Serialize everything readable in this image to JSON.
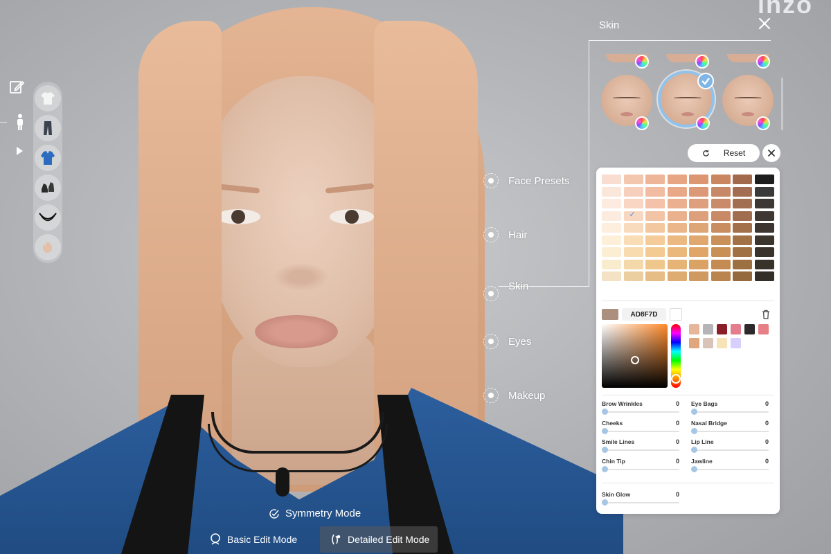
{
  "brand": "inzo",
  "panel": {
    "title": "Skin",
    "reset_label": "Reset"
  },
  "nav": [
    {
      "label": "Face Presets"
    },
    {
      "label": "Hair"
    },
    {
      "label": "Skin"
    },
    {
      "label": "Eyes"
    },
    {
      "label": "Makeup"
    }
  ],
  "rail_items": [
    "t-shirt",
    "pants",
    "jacket",
    "shoes",
    "necklace",
    "hand"
  ],
  "skin_palette": [
    [
      "#f8ddd0",
      "#f3c7ae",
      "#efb598",
      "#e8a583",
      "#dc9672",
      "#c98660",
      "#a3694c",
      "#1d1d1d"
    ],
    [
      "#fbe6da",
      "#f6d0bc",
      "#f1bca2",
      "#e9a989",
      "#dc9978",
      "#c78868",
      "#a36d52",
      "#3a3a3a"
    ],
    [
      "#fdebe0",
      "#f8d6c3",
      "#f3c2a8",
      "#eab090",
      "#de9f7f",
      "#c98b6a",
      "#a36f52",
      "#3e3834"
    ],
    [
      "#fcece0",
      "#f7d7c0",
      "#f2c3a5",
      "#eab18e",
      "#dda07c",
      "#c88a66",
      "#a06d50",
      "#3f3832"
    ],
    [
      "#fdeedd",
      "#f8dbbd",
      "#f3c8a0",
      "#ebb689",
      "#dea576",
      "#c98e60",
      "#a2714b",
      "#3d3630"
    ],
    [
      "#fdefd8",
      "#f9ddb6",
      "#f4cb99",
      "#ecb982",
      "#e0a76e",
      "#ca905a",
      "#a27246",
      "#3b352d"
    ],
    [
      "#fceed3",
      "#f8dcb0",
      "#f3ca92",
      "#ebb87c",
      "#dfa668",
      "#c99055",
      "#a07243",
      "#39332b"
    ],
    [
      "#f9ebcd",
      "#f4d8a9",
      "#efc68c",
      "#e7b477",
      "#daa264",
      "#c48c52",
      "#9c7041",
      "#37322a"
    ],
    [
      "#f3e2c4",
      "#eccfa1",
      "#e6bd85",
      "#deab71",
      "#d0995f",
      "#ba844e",
      "#93693d",
      "#332e27"
    ]
  ],
  "selected_swatch": {
    "row": 3,
    "col": 1
  },
  "current_color": {
    "hex": "AD8F7D",
    "value": "#AD8F7D"
  },
  "recent_colors": [
    "#e6b59a",
    "#b5b5b8",
    "#8a1f2a",
    "#e47d8d",
    "#2e2a2a",
    "#e77f86",
    "#e0a77e",
    "#d8c4b8",
    "#f8e2b8",
    "#d9cfff"
  ],
  "sliders": [
    {
      "label": "Brow Wrinkles",
      "value": "0"
    },
    {
      "label": "Eye Bags",
      "value": "0"
    },
    {
      "label": "Cheeks",
      "value": "0"
    },
    {
      "label": "Nasal Bridge",
      "value": "0"
    },
    {
      "label": "Smile Lines",
      "value": "0"
    },
    {
      "label": "Lip Line",
      "value": "0"
    },
    {
      "label": "Chin Tip",
      "value": "0"
    },
    {
      "label": "Jawline",
      "value": "0"
    }
  ],
  "skin_glow": {
    "label": "Skin Glow",
    "value": "0"
  },
  "bottom": {
    "symmetry_label": "Symmetry Mode",
    "basic_label": "Basic Edit Mode",
    "detailed_label": "Detailed Edit Mode"
  },
  "colors": {
    "accent": "#8fc3ee",
    "slider_knob": "#a7c6e6",
    "jacket": "#2c5f9e"
  }
}
